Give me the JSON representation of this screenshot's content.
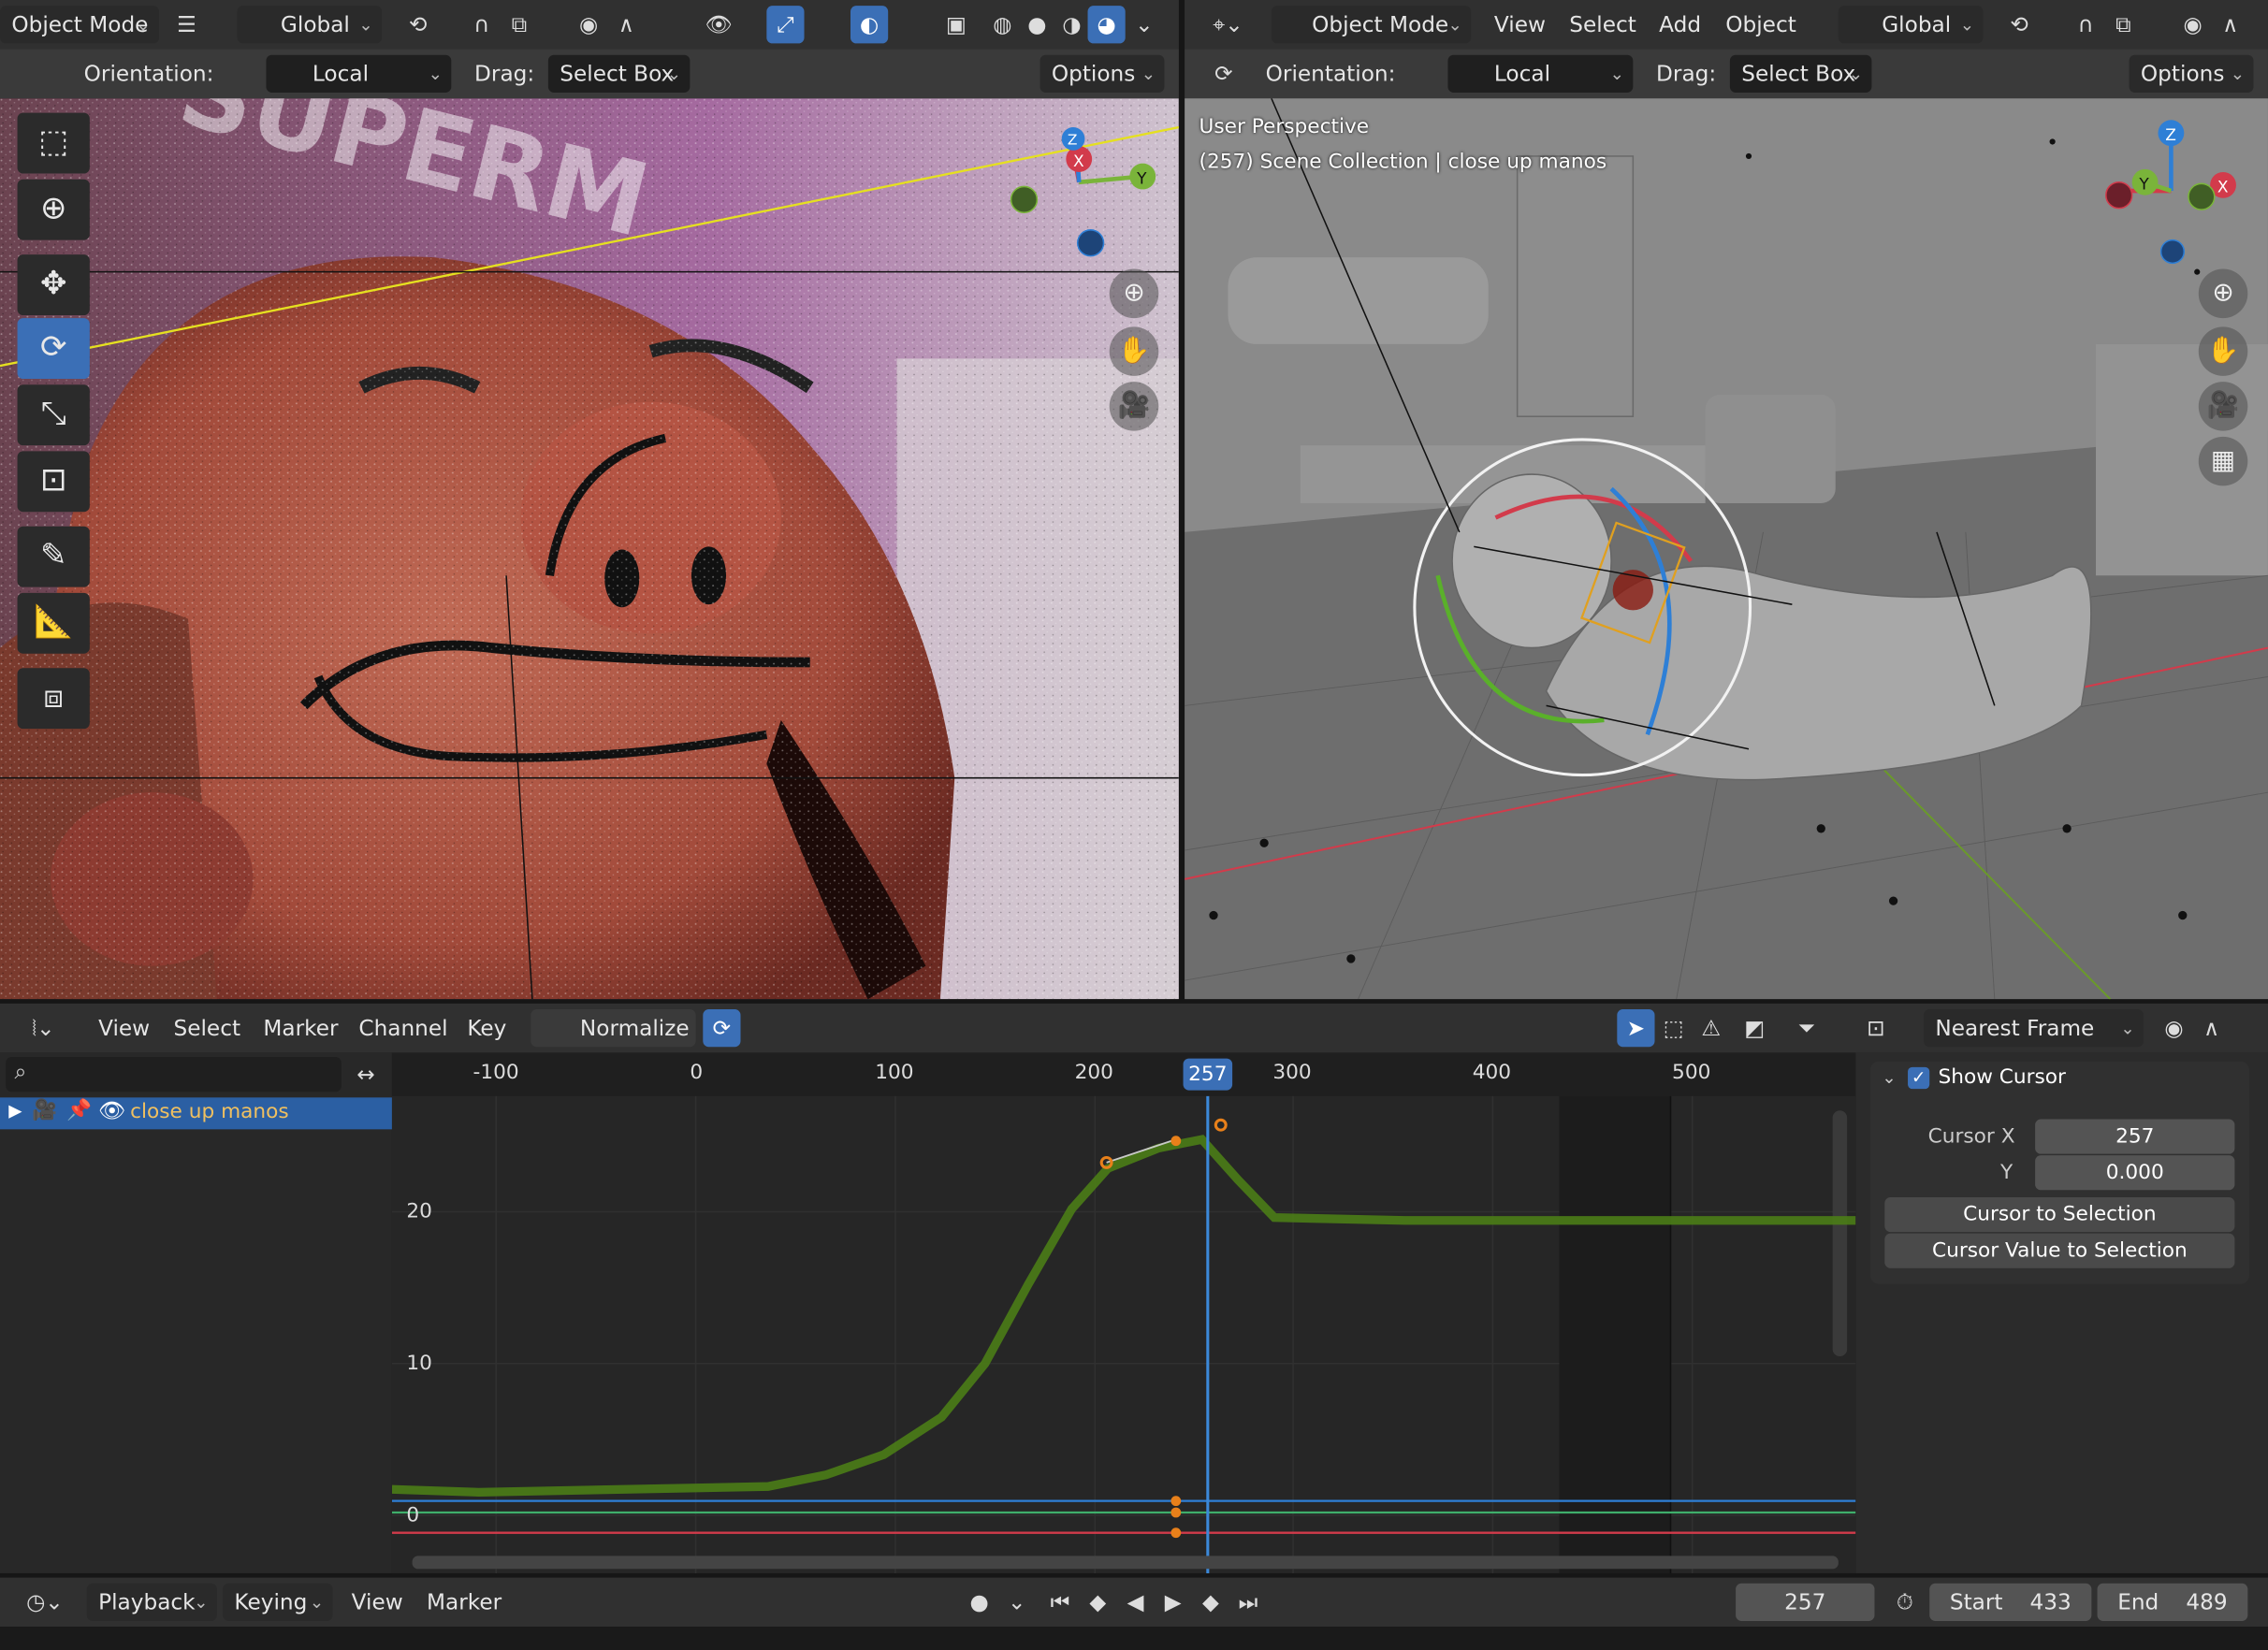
{
  "left_header": {
    "mode": "Object Mode",
    "transform": "Global"
  },
  "left_sub": {
    "orientation_label": "Orientation:",
    "orientation_value": "Local",
    "drag_label": "Drag:",
    "drag_value": "Select Box",
    "options": "Options"
  },
  "right_header": {
    "mode": "Object Mode",
    "menus": [
      "View",
      "Select",
      "Add",
      "Object"
    ],
    "transform": "Global"
  },
  "right_sub": {
    "orientation_label": "Orientation:",
    "orientation_value": "Local",
    "drag_label": "Drag:",
    "drag_value": "Select Box",
    "options": "Options"
  },
  "viewport_right": {
    "perspective": "User Perspective",
    "collection": "(257) Scene Collection | close up manos"
  },
  "graph_header": {
    "menus": [
      "View",
      "Select",
      "Marker",
      "Channel",
      "Key"
    ],
    "normalize": "Normalize",
    "snap": "Nearest Frame"
  },
  "graph": {
    "channel": "close up manos",
    "frame_ticks": [
      "-100",
      "0",
      "100",
      "200",
      "300",
      "400",
      "500"
    ],
    "current_frame": "257",
    "y_ticks": [
      "20",
      "10",
      "0"
    ]
  },
  "sidebar": {
    "show_cursor": "Show Cursor",
    "cursor_x_label": "Cursor X",
    "cursor_x": "257",
    "y_label": "Y",
    "y_value": "0.000",
    "to_selection": "Cursor to Selection",
    "value_to_selection": "Cursor Value to Selection"
  },
  "timeline": {
    "menus": [
      "Playback",
      "Keying",
      "View",
      "Marker"
    ],
    "current": "257",
    "start_label": "Start",
    "start": "433",
    "end_label": "End",
    "end": "489"
  },
  "colors": {
    "accent": "#3b6fb6",
    "curve": "#4b7d17",
    "x_axis": "#d23b4b",
    "y_axis": "#7ab43a",
    "z_axis": "#2e7fd6",
    "keyframe": "#e8801a"
  }
}
